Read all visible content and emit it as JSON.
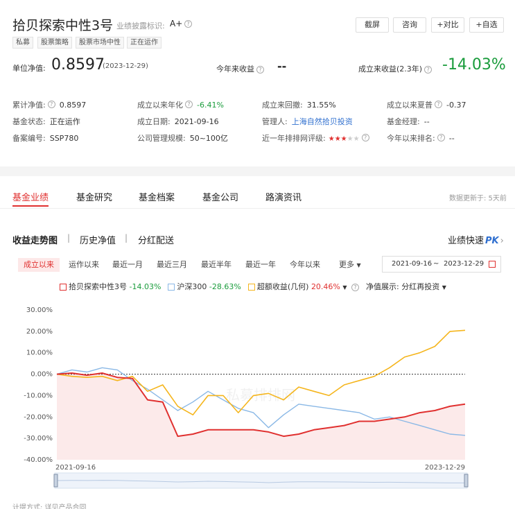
{
  "header": {
    "fund_name": "拾贝探索中性3号",
    "disclosure_label": "业绩披露标识:",
    "disclosure_value": "A+",
    "buttons": [
      "截屏",
      "咨询",
      "+对比",
      "+自选"
    ],
    "tags": [
      "私募",
      "股票策略",
      "股票市场中性",
      "正在运作"
    ],
    "nav_label": "单位净值:",
    "nav_value": "0.8597",
    "nav_date": "(2023-12-29)",
    "ytd_label": "今年来收益",
    "ytd_value": "--",
    "since_label": "成立来收益(2.3年)",
    "since_value": "-14.03%"
  },
  "info": [
    [
      {
        "label": "累计净值:",
        "value": "0.8597",
        "q": true
      },
      {
        "label": "成立以来年化",
        "value": "-6.41%",
        "q": true,
        "color": "green"
      },
      {
        "label": "成立来回撤:",
        "value": "31.55%"
      },
      {
        "label": "成立以来夏普",
        "value": "-0.37",
        "q": true
      }
    ],
    [
      {
        "label": "基金状态:",
        "value": "正在运作"
      },
      {
        "label": "成立日期:",
        "value": "2021-09-16"
      },
      {
        "label": "管理人:",
        "value": "上海自然拾贝投资",
        "color": "blue"
      },
      {
        "label": "基金经理:",
        "value": "--"
      }
    ],
    [
      {
        "label": "备案编号:",
        "value": "SSP780"
      },
      {
        "label": "公司管理规模:",
        "value": "50~100亿"
      },
      {
        "label": "近一年排排网评级:",
        "value": "",
        "stars": 3,
        "q": true
      },
      {
        "label": "今年以来排名:",
        "value": "--",
        "q": true
      }
    ]
  ],
  "tabs": [
    "基金业绩",
    "基金研究",
    "基金档案",
    "基金公司",
    "路演资讯"
  ],
  "update_note": "数据更新于: 5天前",
  "subtabs": [
    "收益走势图",
    "历史净值",
    "分红配送"
  ],
  "pk_label": "业绩快速",
  "pk_badge": "PK",
  "ranges": [
    "成立以来",
    "运作以来",
    "最近一月",
    "最近三月",
    "最近半年",
    "最近一年",
    "今年以来",
    "更多"
  ],
  "date_from": "2021-09-16",
  "date_sep": "~",
  "date_to": "2023-12-29",
  "legend": [
    {
      "name": "拾贝探索中性3号",
      "value": "-14.03%",
      "color": "#e0302f",
      "value_color": "green"
    },
    {
      "name": "沪深300",
      "value": "-28.63%",
      "color": "#8ab8e6",
      "value_color": "green"
    },
    {
      "name": "超额收益(几何)",
      "value": "20.46%",
      "color": "#f5b51c",
      "value_color": "red"
    }
  ],
  "nav_display_label": "净值展示:",
  "nav_display_value": "分红再投资",
  "watermark": "私募排排网",
  "footer_note": "计提方式: 详见产品合同",
  "colors": {
    "accent": "#e0302f",
    "fund": "#e0302f",
    "index": "#8ab8e6",
    "excess": "#f5b51c"
  },
  "chart_data": {
    "type": "line",
    "x": [
      "2021-09-16",
      "2021-10-15",
      "2021-11-15",
      "2021-12-15",
      "2022-01-15",
      "2022-02-15",
      "2022-03-15",
      "2022-04-15",
      "2022-05-15",
      "2022-06-15",
      "2022-07-15",
      "2022-08-15",
      "2022-09-15",
      "2022-10-15",
      "2022-11-15",
      "2022-12-15",
      "2023-01-15",
      "2023-02-15",
      "2023-03-15",
      "2023-04-15",
      "2023-05-15",
      "2023-06-15",
      "2023-07-15",
      "2023-08-15",
      "2023-09-15",
      "2023-10-15",
      "2023-11-15",
      "2023-12-29"
    ],
    "series": [
      {
        "name": "拾贝探索中性3号",
        "values": [
          0,
          0.5,
          -0.5,
          0.5,
          -1.5,
          -2,
          -12,
          -13,
          -29,
          -28,
          -26,
          -26,
          -26,
          -26,
          -27,
          -29,
          -28,
          -26,
          -25,
          -24,
          -22,
          -22,
          -21,
          -20,
          -18,
          -17,
          -15,
          -14
        ]
      },
      {
        "name": "沪深300",
        "values": [
          0,
          2,
          1,
          3,
          2,
          -3,
          -7,
          -12,
          -17,
          -13,
          -8,
          -12,
          -16,
          -18,
          -25,
          -19,
          -14,
          -15,
          -16,
          -17,
          -18,
          -21,
          -20,
          -22,
          -24,
          -26,
          -28,
          -28.6
        ]
      },
      {
        "name": "超额收益(几何)",
        "values": [
          0,
          -1,
          -1.5,
          -1,
          -3,
          -1,
          -8,
          -5,
          -15,
          -19,
          -10,
          -10,
          -18,
          -10,
          -9,
          -12,
          -6,
          -8,
          -10,
          -5,
          -3,
          -1,
          3,
          8,
          10,
          13,
          20,
          20.5
        ]
      }
    ],
    "ylim": [
      -40,
      30
    ],
    "yticks": [
      "30.00%",
      "20.00%",
      "10.00%",
      "0.00%",
      "-10.00%",
      "-20.00%",
      "-30.00%",
      "-40.00%"
    ],
    "xtick_labels": [
      "2021-09-16",
      "2023-12-29"
    ],
    "grid": false
  }
}
